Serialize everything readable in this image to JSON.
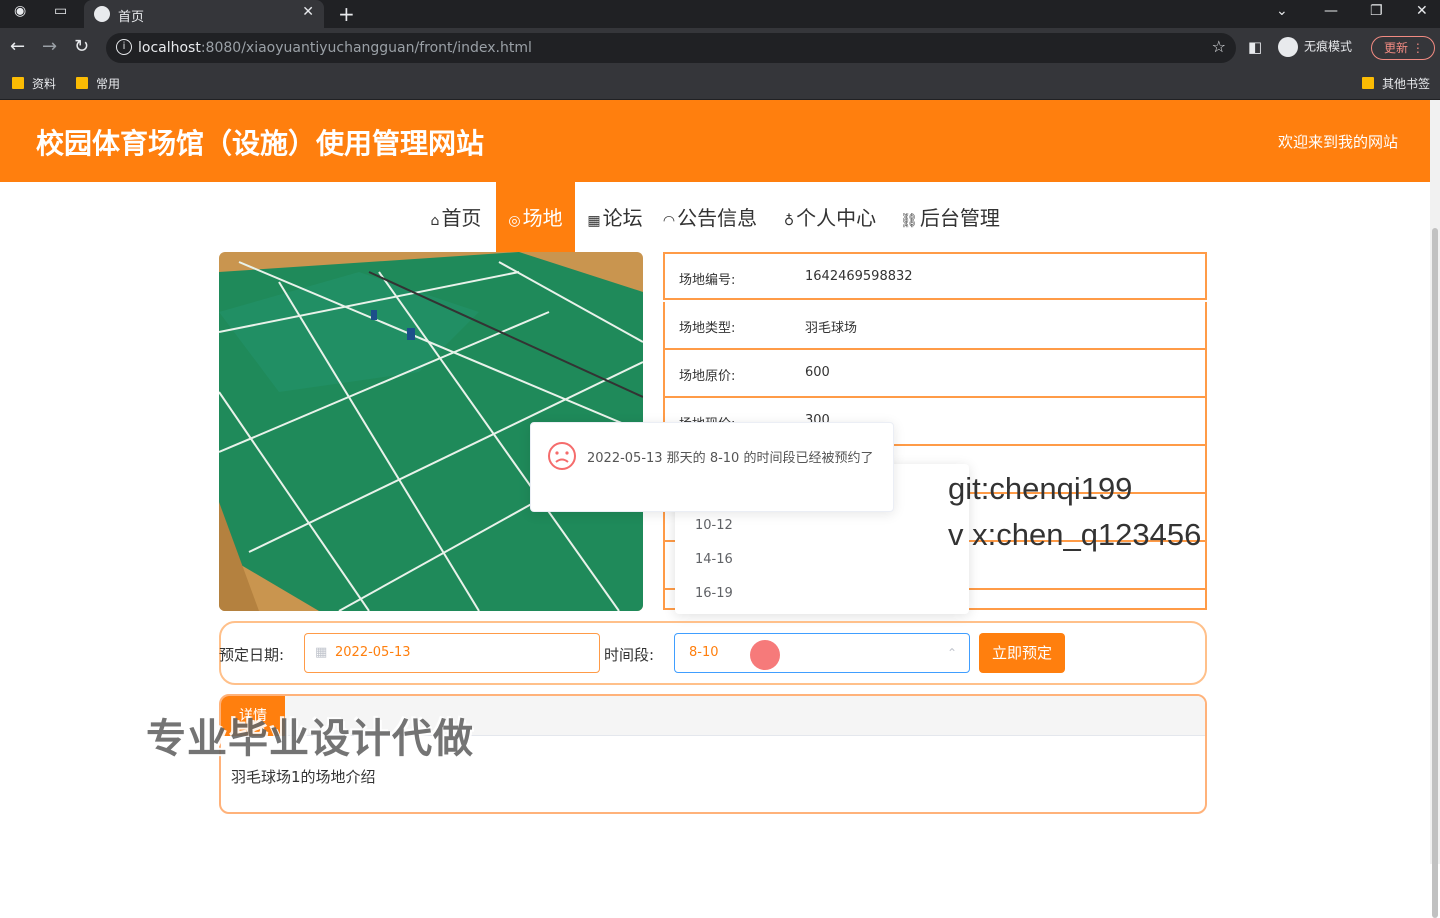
{
  "browser": {
    "tab_title": "首页",
    "url_host": "localhost",
    "url_rest": ":8080/xiaoyuantiyuchangguan/front/index.html",
    "incognito_label": "无痕模式",
    "update_label": "更新",
    "bookmarks": [
      "资料",
      "常用"
    ],
    "other_bookmarks": "其他书签"
  },
  "site": {
    "title": "校园体育场馆（设施）使用管理网站",
    "welcome": "欢迎来到我的网站"
  },
  "nav": [
    {
      "label": "首页",
      "icon": "home-icon"
    },
    {
      "label": "场地",
      "icon": "venue-icon"
    },
    {
      "label": "论坛",
      "icon": "forum-icon"
    },
    {
      "label": "公告信息",
      "icon": "notice-icon"
    },
    {
      "label": "个人中心",
      "icon": "user-icon"
    },
    {
      "label": "后台管理",
      "icon": "link-icon"
    }
  ],
  "info_rows": [
    {
      "key": "场地编号:",
      "value": "1642469598832"
    },
    {
      "key": "场地类型:",
      "value": "羽毛球场"
    },
    {
      "key": "场地原价:",
      "value": "600"
    },
    {
      "key": "场地现价:",
      "value": "300"
    }
  ],
  "timeslot_options": [
    "10-12",
    "14-16",
    "16-19"
  ],
  "toast": {
    "message": "2022-05-13 那天的 8-10 的时间段已经被预约了"
  },
  "booking": {
    "date_label": "预定日期:",
    "date_value": "2022-05-13",
    "slot_label": "时间段:",
    "slot_value": "8-10",
    "book_button": "立即预定"
  },
  "detail": {
    "tab_label": "详情",
    "text": "羽毛球场1的场地介绍"
  },
  "watermarks": {
    "line1": "git:chenqi199",
    "line2": "v x:chen_q123456",
    "big": "专业毕业设计代做"
  },
  "colors": {
    "accent": "#ff7f0e",
    "error": "#f56c6c"
  }
}
